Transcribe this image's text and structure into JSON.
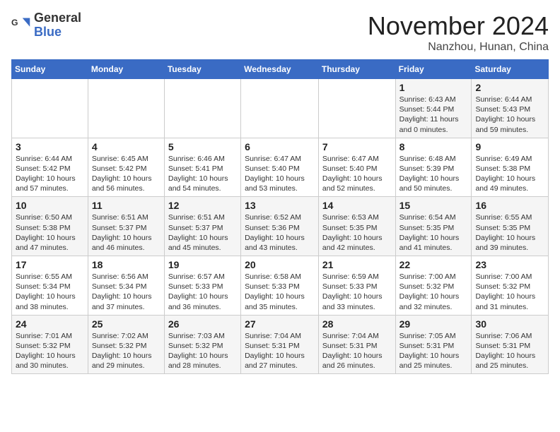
{
  "header": {
    "logo_general": "General",
    "logo_blue": "Blue",
    "month": "November 2024",
    "location": "Nanzhou, Hunan, China"
  },
  "weekdays": [
    "Sunday",
    "Monday",
    "Tuesday",
    "Wednesday",
    "Thursday",
    "Friday",
    "Saturday"
  ],
  "weeks": [
    [
      {
        "day": "",
        "info": ""
      },
      {
        "day": "",
        "info": ""
      },
      {
        "day": "",
        "info": ""
      },
      {
        "day": "",
        "info": ""
      },
      {
        "day": "",
        "info": ""
      },
      {
        "day": "1",
        "info": "Sunrise: 6:43 AM\nSunset: 5:44 PM\nDaylight: 11 hours\nand 0 minutes."
      },
      {
        "day": "2",
        "info": "Sunrise: 6:44 AM\nSunset: 5:43 PM\nDaylight: 10 hours\nand 59 minutes."
      }
    ],
    [
      {
        "day": "3",
        "info": "Sunrise: 6:44 AM\nSunset: 5:42 PM\nDaylight: 10 hours\nand 57 minutes."
      },
      {
        "day": "4",
        "info": "Sunrise: 6:45 AM\nSunset: 5:42 PM\nDaylight: 10 hours\nand 56 minutes."
      },
      {
        "day": "5",
        "info": "Sunrise: 6:46 AM\nSunset: 5:41 PM\nDaylight: 10 hours\nand 54 minutes."
      },
      {
        "day": "6",
        "info": "Sunrise: 6:47 AM\nSunset: 5:40 PM\nDaylight: 10 hours\nand 53 minutes."
      },
      {
        "day": "7",
        "info": "Sunrise: 6:47 AM\nSunset: 5:40 PM\nDaylight: 10 hours\nand 52 minutes."
      },
      {
        "day": "8",
        "info": "Sunrise: 6:48 AM\nSunset: 5:39 PM\nDaylight: 10 hours\nand 50 minutes."
      },
      {
        "day": "9",
        "info": "Sunrise: 6:49 AM\nSunset: 5:38 PM\nDaylight: 10 hours\nand 49 minutes."
      }
    ],
    [
      {
        "day": "10",
        "info": "Sunrise: 6:50 AM\nSunset: 5:38 PM\nDaylight: 10 hours\nand 47 minutes."
      },
      {
        "day": "11",
        "info": "Sunrise: 6:51 AM\nSunset: 5:37 PM\nDaylight: 10 hours\nand 46 minutes."
      },
      {
        "day": "12",
        "info": "Sunrise: 6:51 AM\nSunset: 5:37 PM\nDaylight: 10 hours\nand 45 minutes."
      },
      {
        "day": "13",
        "info": "Sunrise: 6:52 AM\nSunset: 5:36 PM\nDaylight: 10 hours\nand 43 minutes."
      },
      {
        "day": "14",
        "info": "Sunrise: 6:53 AM\nSunset: 5:35 PM\nDaylight: 10 hours\nand 42 minutes."
      },
      {
        "day": "15",
        "info": "Sunrise: 6:54 AM\nSunset: 5:35 PM\nDaylight: 10 hours\nand 41 minutes."
      },
      {
        "day": "16",
        "info": "Sunrise: 6:55 AM\nSunset: 5:35 PM\nDaylight: 10 hours\nand 39 minutes."
      }
    ],
    [
      {
        "day": "17",
        "info": "Sunrise: 6:55 AM\nSunset: 5:34 PM\nDaylight: 10 hours\nand 38 minutes."
      },
      {
        "day": "18",
        "info": "Sunrise: 6:56 AM\nSunset: 5:34 PM\nDaylight: 10 hours\nand 37 minutes."
      },
      {
        "day": "19",
        "info": "Sunrise: 6:57 AM\nSunset: 5:33 PM\nDaylight: 10 hours\nand 36 minutes."
      },
      {
        "day": "20",
        "info": "Sunrise: 6:58 AM\nSunset: 5:33 PM\nDaylight: 10 hours\nand 35 minutes."
      },
      {
        "day": "21",
        "info": "Sunrise: 6:59 AM\nSunset: 5:33 PM\nDaylight: 10 hours\nand 33 minutes."
      },
      {
        "day": "22",
        "info": "Sunrise: 7:00 AM\nSunset: 5:32 PM\nDaylight: 10 hours\nand 32 minutes."
      },
      {
        "day": "23",
        "info": "Sunrise: 7:00 AM\nSunset: 5:32 PM\nDaylight: 10 hours\nand 31 minutes."
      }
    ],
    [
      {
        "day": "24",
        "info": "Sunrise: 7:01 AM\nSunset: 5:32 PM\nDaylight: 10 hours\nand 30 minutes."
      },
      {
        "day": "25",
        "info": "Sunrise: 7:02 AM\nSunset: 5:32 PM\nDaylight: 10 hours\nand 29 minutes."
      },
      {
        "day": "26",
        "info": "Sunrise: 7:03 AM\nSunset: 5:32 PM\nDaylight: 10 hours\nand 28 minutes."
      },
      {
        "day": "27",
        "info": "Sunrise: 7:04 AM\nSunset: 5:31 PM\nDaylight: 10 hours\nand 27 minutes."
      },
      {
        "day": "28",
        "info": "Sunrise: 7:04 AM\nSunset: 5:31 PM\nDaylight: 10 hours\nand 26 minutes."
      },
      {
        "day": "29",
        "info": "Sunrise: 7:05 AM\nSunset: 5:31 PM\nDaylight: 10 hours\nand 25 minutes."
      },
      {
        "day": "30",
        "info": "Sunrise: 7:06 AM\nSunset: 5:31 PM\nDaylight: 10 hours\nand 25 minutes."
      }
    ]
  ]
}
